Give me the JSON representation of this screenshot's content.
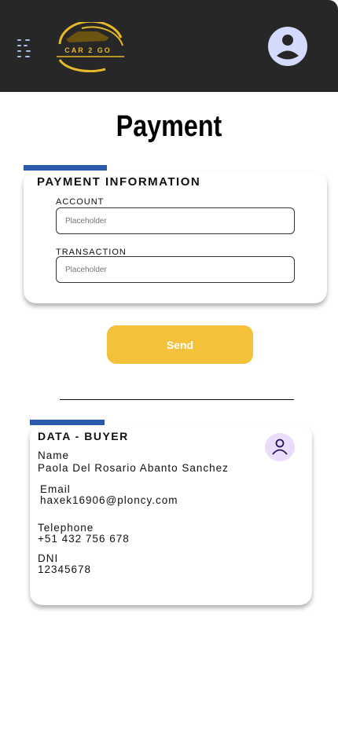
{
  "header": {
    "logo_text": "CAR 2 GO",
    "menu_icon": "menu-icon",
    "profile_icon": "account-circle-icon"
  },
  "page_title": "Payment",
  "payment": {
    "title": "PAYMENT INFORMATION",
    "account_label": "ACCOUNT",
    "account_placeholder": "Placeholder",
    "transaction_label": "TRANSACTION",
    "transaction_placeholder": "Placeholder"
  },
  "send_label": "Send",
  "buyer": {
    "title": "DATA - BUYER",
    "name_label": "Name",
    "name": "Paola Del Rosario Abanto Sanchez",
    "email_label": "Email",
    "email": "haxek16906@ploncy.com",
    "phone_label": "Telephone",
    "phone": "+51 432 756 678",
    "dni_label": "DNI",
    "dni": "12345678"
  },
  "colors": {
    "header": "#272727",
    "accent": "#2b59ac",
    "button": "#f3c13a"
  }
}
